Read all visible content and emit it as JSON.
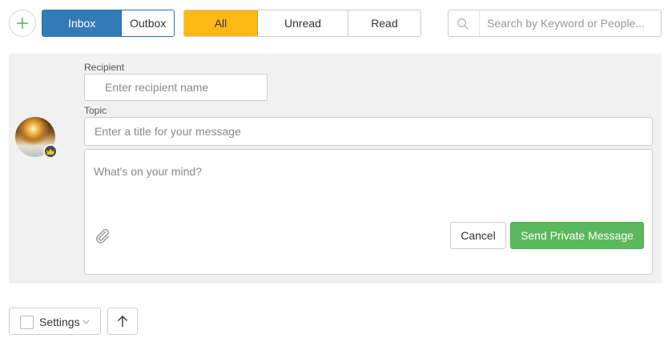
{
  "toolbar": {
    "new_message_icon": "plus-circle-icon",
    "folder_tabs": [
      {
        "label": "Inbox",
        "active": true
      },
      {
        "label": "Outbox",
        "active": false
      }
    ],
    "filter_tabs": [
      {
        "label": "All",
        "active": true
      },
      {
        "label": "Unread",
        "active": false
      },
      {
        "label": "Read",
        "active": false
      }
    ],
    "search": {
      "placeholder": "Search by Keyword or People...",
      "value": "",
      "icon": "search-icon"
    }
  },
  "compose": {
    "avatar_badge_icon": "crown-icon",
    "recipient": {
      "label": "Recipient",
      "placeholder": "Enter recipient name",
      "value": ""
    },
    "topic": {
      "label": "Topic",
      "placeholder": "Enter a title for your message",
      "value": ""
    },
    "message": {
      "placeholder": "What's on your mind?",
      "value": ""
    },
    "attach_icon": "paperclip-icon",
    "cancel_label": "Cancel",
    "send_label": "Send Private Message"
  },
  "footer": {
    "settings_label": "Settings",
    "settings_caret_icon": "chevron-down-icon",
    "scroll_top_icon": "arrow-up-icon"
  },
  "colors": {
    "inbox_active": "#337ab7",
    "filter_active": "#fdb913",
    "send_button": "#5cb85c",
    "panel_background": "#f1f1f1"
  }
}
